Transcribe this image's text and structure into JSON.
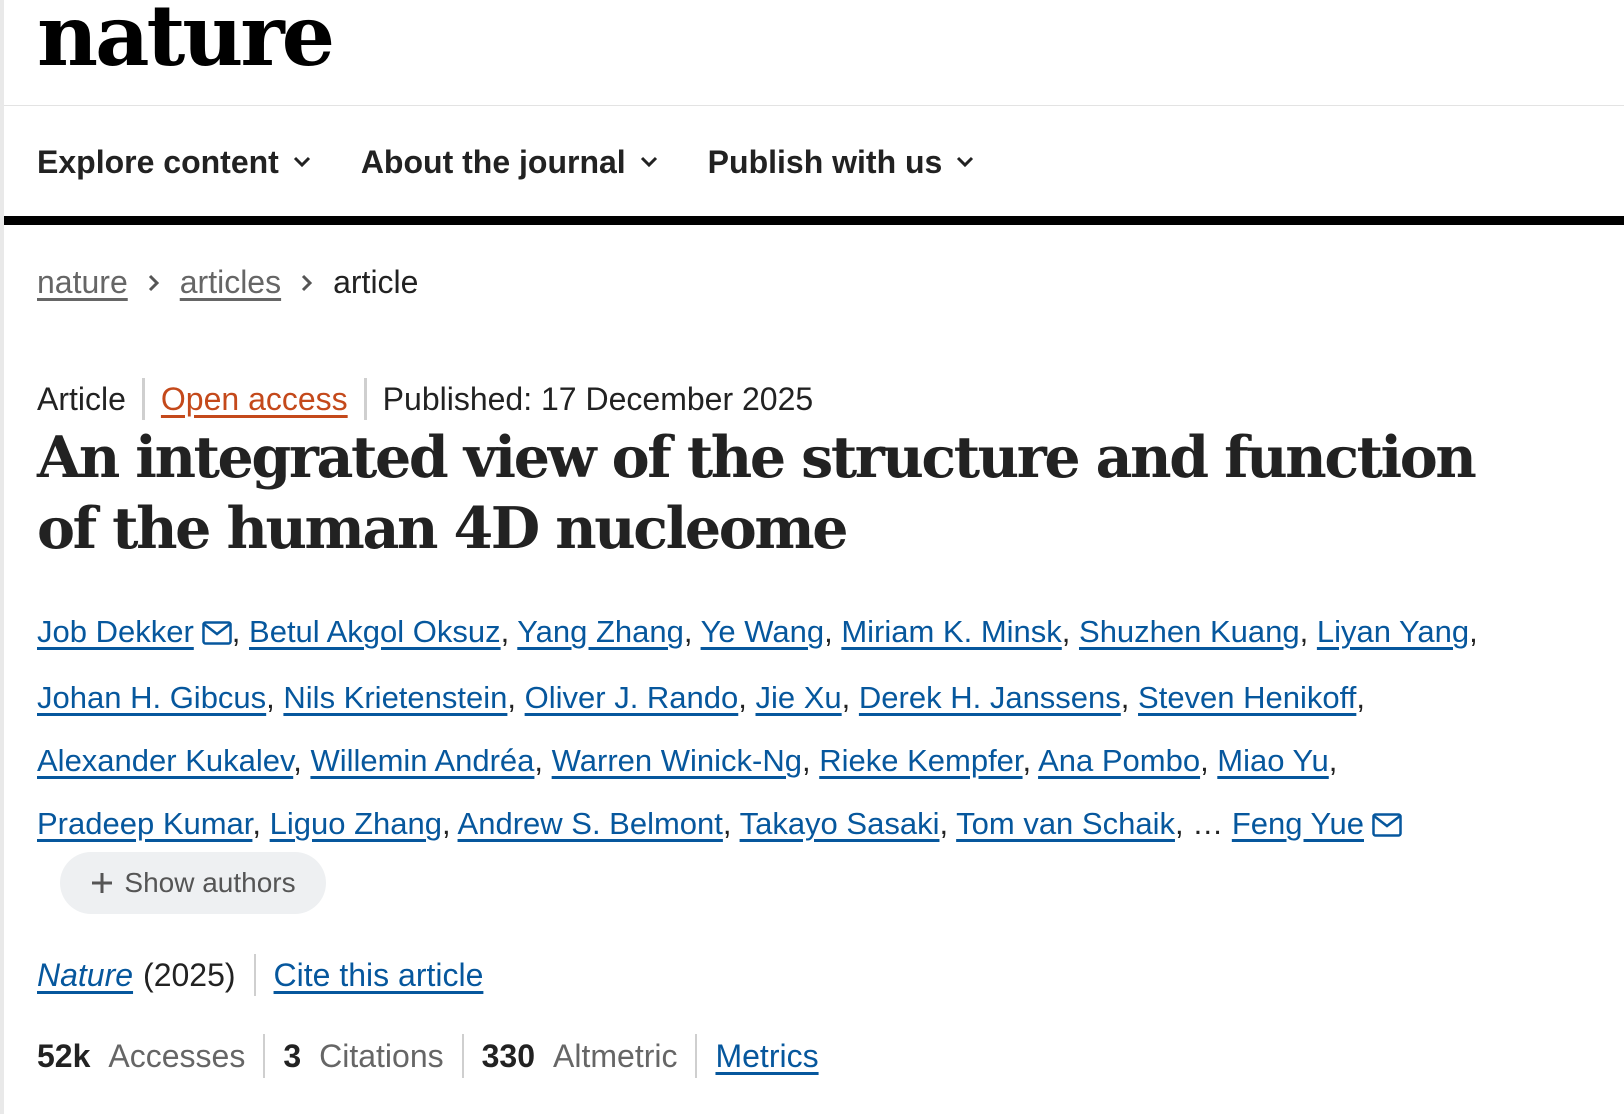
{
  "brand": {
    "logo": "nature"
  },
  "nav": {
    "items": [
      {
        "label": "Explore content"
      },
      {
        "label": "About the journal"
      },
      {
        "label": "Publish with us"
      }
    ]
  },
  "breadcrumb": {
    "items": [
      {
        "label": "nature"
      },
      {
        "label": "articles"
      },
      {
        "label": "article"
      }
    ]
  },
  "article": {
    "type": "Article",
    "access": "Open access",
    "published": "Published: 17 December 2025",
    "title": "An integrated view of the structure and function of the human 4D nucleome",
    "authors": [
      "Job Dekker",
      "Betul Akgol Oksuz",
      "Yang Zhang",
      "Ye Wang",
      "Miriam K. Minsk",
      "Shuzhen Kuang",
      "Liyan Yang",
      "Johan H. Gibcus",
      "Nils Krietenstein",
      "Oliver J. Rando",
      "Jie Xu",
      "Derek H. Janssens",
      "Steven Henikoff",
      "Alexander Kukalev",
      "Willemin Andréa",
      "Warren Winick-Ng",
      "Rieke Kempfer",
      "Ana Pombo",
      "Miao Yu",
      "Pradeep Kumar",
      "Liguo Zhang",
      "Andrew S. Belmont",
      "Takayo Sasaki",
      "Tom van Schaik"
    ],
    "ellipsis": "…",
    "last_author": "Feng Yue",
    "show_authors": "Show authors",
    "journal": "Nature",
    "year": "(2025)",
    "cite": "Cite this article"
  },
  "metrics": {
    "accesses_value": "52k",
    "accesses_label": "Accesses",
    "citations_value": "3",
    "citations_label": "Citations",
    "altmetric_value": "330",
    "altmetric_label": "Altmetric",
    "link": "Metrics"
  },
  "colors": {
    "link": "#06579d",
    "open_access": "#c4491b",
    "text": "#222222",
    "muted": "#666666"
  }
}
